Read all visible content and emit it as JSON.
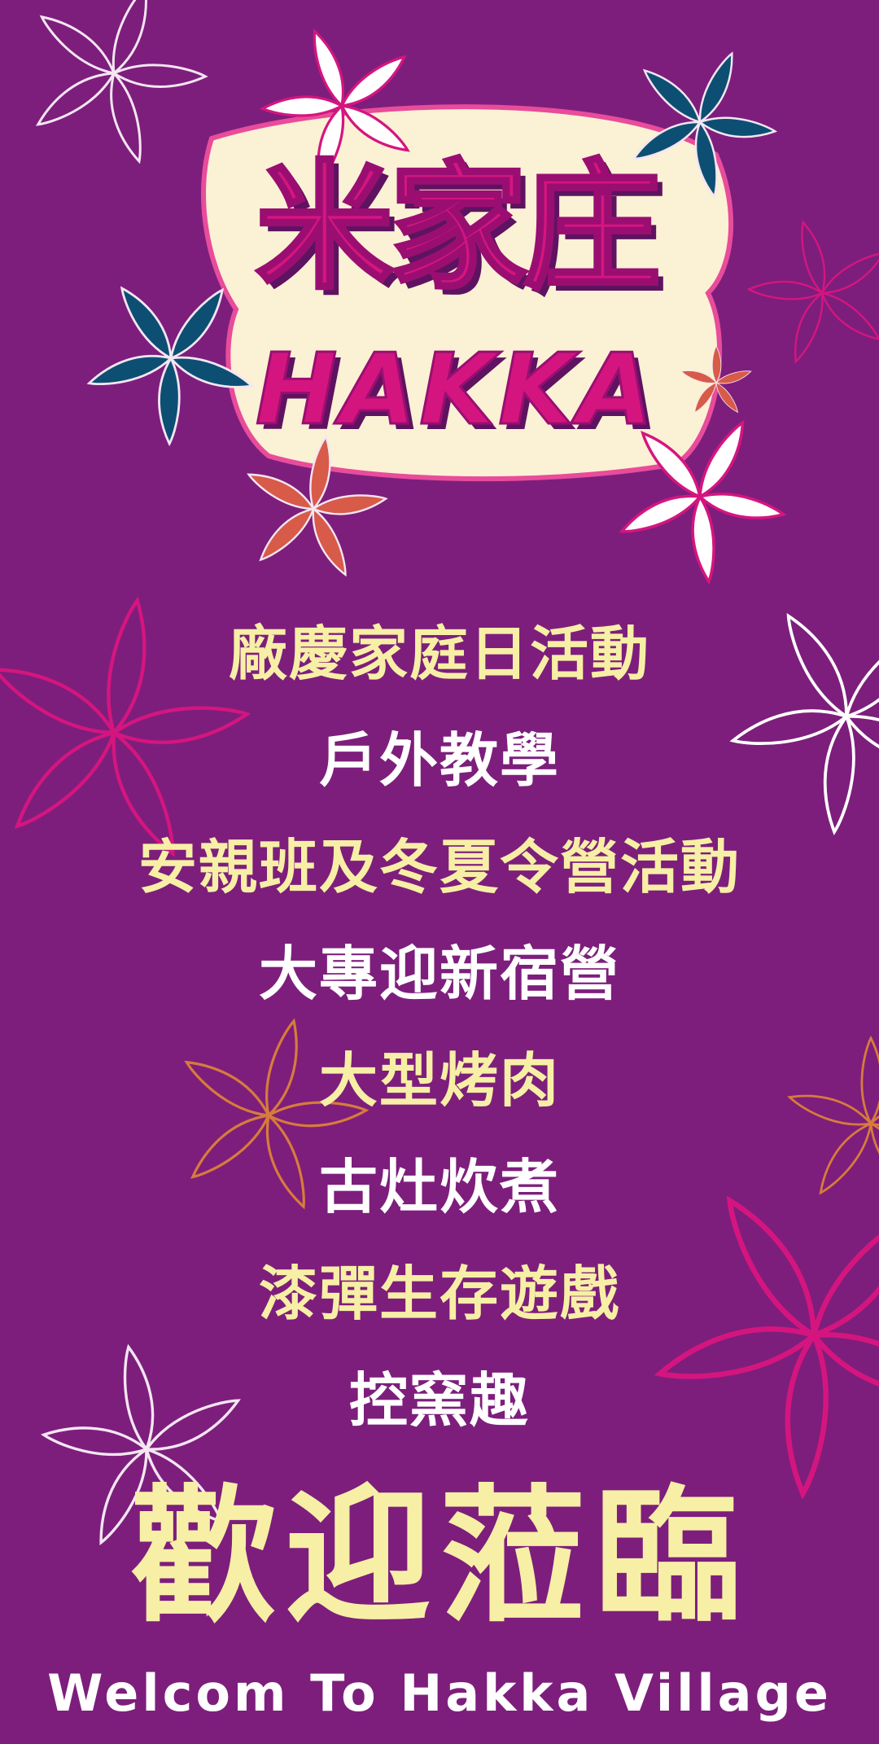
{
  "logo": {
    "title_cn": "米家庄",
    "title_en": "HAKKA"
  },
  "activities": [
    {
      "label": "廠慶家庭日活動",
      "color": "#f7efa6"
    },
    {
      "label": "戶外教學",
      "color": "#ffffff"
    },
    {
      "label": "安親班及冬夏令營活動",
      "color": "#f7efa6"
    },
    {
      "label": "大專迎新宿營",
      "color": "#ffffff"
    },
    {
      "label": "大型烤肉",
      "color": "#f7efa6"
    },
    {
      "label": "古灶炊煮",
      "color": "#ffffff"
    },
    {
      "label": "漆彈生存遊戲",
      "color": "#f7efa6"
    },
    {
      "label": "控窯趣",
      "color": "#ffffff"
    }
  ],
  "welcome": {
    "cn": "歡迎蒞臨",
    "en": "Welcom To Hakka Village"
  },
  "colors": {
    "background": "#7d1e7c",
    "logo_pink": "#d5157f",
    "logo_cream": "#fbf1d5",
    "accent_yellow": "#f7efa6",
    "white": "#ffffff",
    "teal": "#0d4f73",
    "coral": "#d75b48"
  }
}
